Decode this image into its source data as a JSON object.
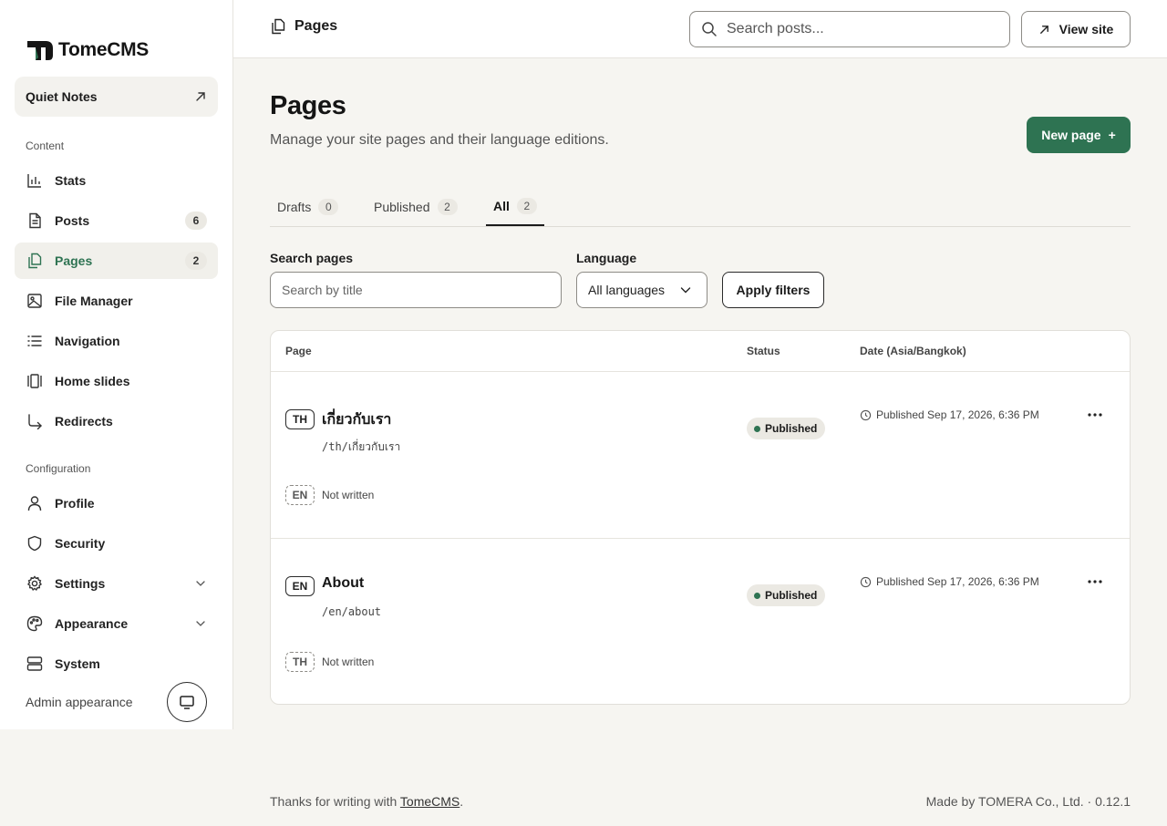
{
  "app": {
    "logo_text": "TomeCMS",
    "site_name": "Quiet Notes"
  },
  "sidebar": {
    "sections": [
      {
        "label": "Content"
      },
      {
        "label": "Configuration"
      }
    ],
    "items": [
      {
        "label": "Stats",
        "icon": "bar-chart-icon"
      },
      {
        "label": "Posts",
        "icon": "document-icon",
        "count": "6"
      },
      {
        "label": "Pages",
        "icon": "pages-icon",
        "count": "2",
        "active": true
      },
      {
        "label": "File Manager",
        "icon": "image-icon"
      },
      {
        "label": "Navigation",
        "icon": "list-icon"
      },
      {
        "label": "Home slides",
        "icon": "slides-icon"
      },
      {
        "label": "Redirects",
        "icon": "redirect-arrow-icon"
      },
      {
        "label": "Profile",
        "icon": "user-icon"
      },
      {
        "label": "Security",
        "icon": "shield-icon"
      },
      {
        "label": "Settings",
        "icon": "gear-icon"
      },
      {
        "label": "Appearance",
        "icon": "palette-icon"
      },
      {
        "label": "System",
        "icon": "server-icon"
      }
    ],
    "admin_appearance_label": "Admin appearance"
  },
  "topbar": {
    "breadcrumb": "Pages",
    "search_placeholder": "Search posts...",
    "view_site_label": "View site"
  },
  "page": {
    "title": "Pages",
    "subtitle": "Manage your site pages and their language editions.",
    "new_page_label": "New page",
    "new_page_plus": "+"
  },
  "tabs": [
    {
      "label": "Drafts",
      "count": "0"
    },
    {
      "label": "Published",
      "count": "2"
    },
    {
      "label": "All",
      "count": "2",
      "active": true
    }
  ],
  "filters": {
    "search_label": "Search pages",
    "search_placeholder": "Search by title",
    "language_label": "Language",
    "language_value": "All languages",
    "apply_label": "Apply filters"
  },
  "table": {
    "headers": {
      "page": "Page",
      "status": "Status",
      "date": "Date (Asia/Bangkok)"
    },
    "rows": [
      {
        "lang": "TH",
        "title": "เกี่ยวกับเรา",
        "slug": "/th/เกี่ยวกับเรา",
        "status": "Published",
        "date": "Published Sep 17, 2026, 6:36 PM",
        "other_lang": "EN",
        "other_status": "Not written"
      },
      {
        "lang": "EN",
        "title": "About",
        "slug": "/en/about",
        "status": "Published",
        "date": "Published Sep 17, 2026, 6:36 PM",
        "other_lang": "TH",
        "other_status": "Not written"
      }
    ]
  },
  "footer": {
    "left_prefix": "Thanks for writing with ",
    "left_link": "TomeCMS",
    "left_suffix": ".",
    "right": "Made by TOMERA Co., Ltd. · 0.12.1"
  },
  "colors": {
    "accent": "#2e7352",
    "background": "#f6f5f1",
    "surface": "#ffffff",
    "badge": "#ebe9e3"
  }
}
